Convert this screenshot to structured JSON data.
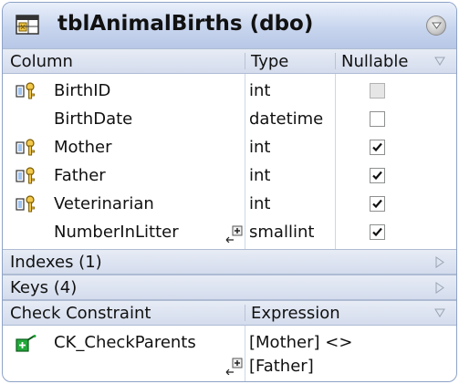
{
  "window": {
    "title": "tblAnimalBirths (dbo)"
  },
  "columns_header": {
    "column": "Column",
    "type": "Type",
    "nullable": "Nullable"
  },
  "columns": [
    {
      "name": "BirthID",
      "type": "int",
      "nullable": false,
      "nullable_disabled": true,
      "icon": "key-icon"
    },
    {
      "name": "BirthDate",
      "type": "datetime",
      "nullable": false,
      "nullable_disabled": false,
      "icon": ""
    },
    {
      "name": "Mother",
      "type": "int",
      "nullable": true,
      "nullable_disabled": false,
      "icon": "key-icon"
    },
    {
      "name": "Father",
      "type": "int",
      "nullable": true,
      "nullable_disabled": false,
      "icon": "key-icon"
    },
    {
      "name": "Veterinarian",
      "type": "int",
      "nullable": true,
      "nullable_disabled": false,
      "icon": "key-icon"
    },
    {
      "name": "NumberInLitter",
      "type": "smallint",
      "nullable": true,
      "nullable_disabled": false,
      "icon": ""
    }
  ],
  "sections": {
    "indexes": "Indexes (1)",
    "keys": "Keys (4)"
  },
  "check_header": {
    "constraint": "Check Constraint",
    "expression": "Expression"
  },
  "check_constraints": [
    {
      "name": "CK_CheckParents",
      "expression_line1": "[Mother] <>",
      "expression_line2": "[Father]"
    }
  ],
  "colors": {
    "title_gradient_top": "#eaf0fb",
    "title_gradient_bottom": "#b7c7e6",
    "border": "#8ea3c7",
    "key_icon_yellow": "#f2c94c",
    "constraint_icon_green": "#22a83a"
  }
}
